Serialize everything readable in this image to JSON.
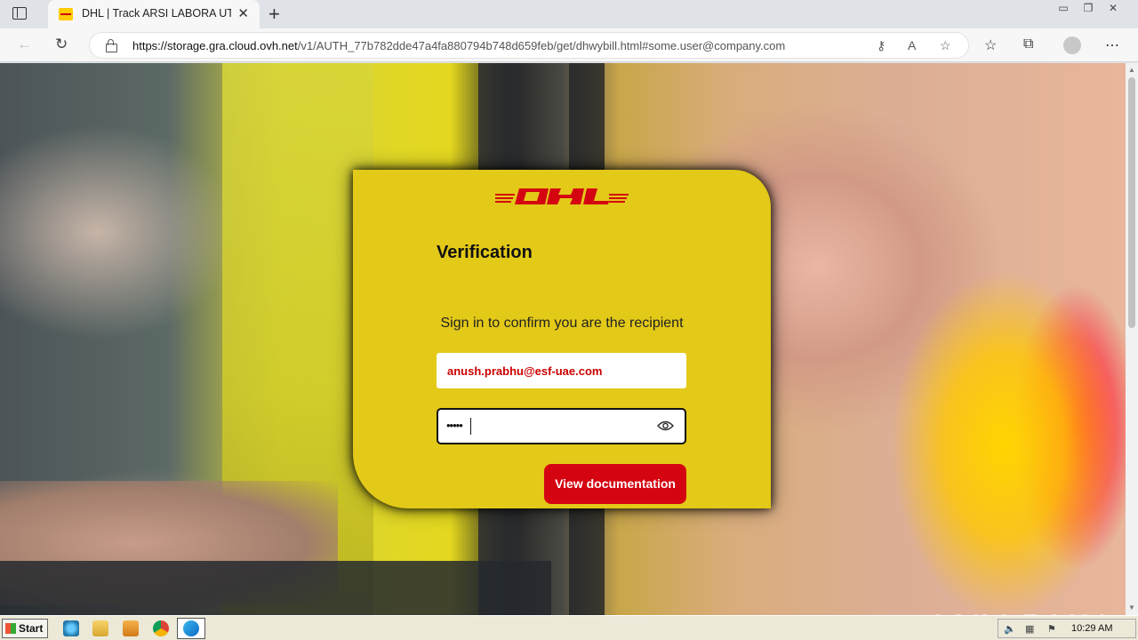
{
  "browser": {
    "tab_title": "DHL | Track ARSI LABORA UTAMA",
    "url_host": "https://storage.gra.cloud.ovh.net",
    "url_path": "/v1/AUTH_77b782dde47a4fa880794b748d659feb/get/dhwybill.html#some.user@company.com"
  },
  "page": {
    "logo_text": "DHL",
    "title": "Verification",
    "subtitle": "Sign in to confirm you are the recipient",
    "email_value": "anush.prabhu@esf-uae.com",
    "password_dots": "•••••",
    "button_label": "View documentation"
  },
  "watermark": "ANY RUN",
  "taskbar": {
    "start_label": "Start",
    "clock": "10:29 AM"
  },
  "colors": {
    "dhl_yellow": "#e3c918",
    "dhl_red": "#d40511"
  }
}
